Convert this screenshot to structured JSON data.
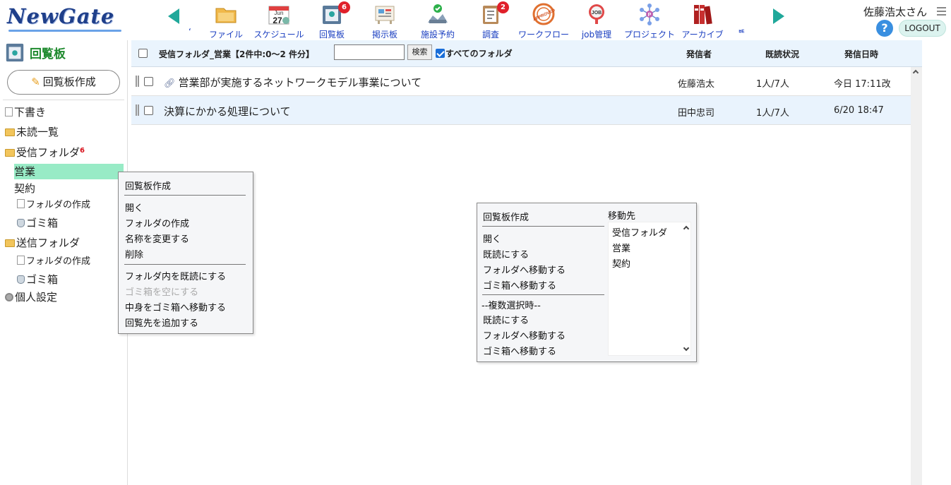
{
  "header": {
    "logo_part1": "New",
    "logo_part2": "Gate",
    "nav_fragment_left": "ʻ",
    "nav_fragment_right": "ᄩ",
    "nav_items": [
      {
        "label": "ファイル",
        "icon": "folder-icon",
        "badge": ""
      },
      {
        "label": "スケジュール",
        "icon": "calendar-icon",
        "badge": "",
        "icon_text_month": "Jun",
        "icon_text_day": "27"
      },
      {
        "label": "回覧板",
        "icon": "circular-board-icon",
        "badge": "6"
      },
      {
        "label": "掲示板",
        "icon": "bulletin-board-icon",
        "badge": ""
      },
      {
        "label": "施設予約",
        "icon": "facility-icon",
        "badge": ""
      },
      {
        "label": "調査",
        "icon": "survey-icon",
        "badge": "2"
      },
      {
        "label": "ワークフロー",
        "icon": "workflow-icon",
        "badge": "",
        "icon_text": "APPROVED"
      },
      {
        "label": "job管理",
        "icon": "job-icon",
        "badge": "",
        "icon_text": "JOB"
      },
      {
        "label": "プロジェクト",
        "icon": "project-icon",
        "badge": "",
        "icon_text": "P"
      },
      {
        "label": "アーカイブ",
        "icon": "archive-icon",
        "badge": ""
      }
    ],
    "user_name": "佐藤浩太さん",
    "help_label": "?",
    "logout_label": "LOGOUT"
  },
  "sidebar": {
    "app_title": "回覧板",
    "create_label": "回覧板作成",
    "tree": [
      {
        "label": "下書き",
        "icon": "document-icon"
      },
      {
        "label": "未読一覧",
        "icon": "unread-icon"
      },
      {
        "label": "受信フォルダ",
        "icon": "folder-icon",
        "badge": "6"
      },
      {
        "label": "営業",
        "icon": "",
        "selected": true
      },
      {
        "label": "契約",
        "icon": ""
      },
      {
        "label": "フォルダの作成",
        "icon": "new-folder-icon"
      },
      {
        "label": "ゴミ箱",
        "icon": "trash-icon"
      },
      {
        "label": "送信フォルダ",
        "icon": "folder-icon"
      },
      {
        "label": "フォルダの作成",
        "icon": "new-folder-icon"
      },
      {
        "label": "ゴミ箱",
        "icon": "trash-icon"
      },
      {
        "label": "個人設定",
        "icon": "gear-icon"
      }
    ]
  },
  "toolbar": {
    "title": "受信フォルダ_営業【2件中:0～2 件分】",
    "search_value": "",
    "search_button": "検索",
    "all_folders_label": "すべてのフォルダ",
    "all_folders_checked": true,
    "col_sender": "発信者",
    "col_read": "既読状況",
    "col_date": "発信日時"
  },
  "messages": [
    {
      "subject": "営業部が実施するネットワークモデル事業について",
      "attachment": true,
      "sender": "佐藤浩太",
      "read": "1人/7人",
      "date": "今日 17:11改"
    },
    {
      "subject": "決算にかかる処理について",
      "attachment": false,
      "sender": "田中忠司",
      "read": "1人/7人",
      "date": "6/20 18:47"
    }
  ],
  "folder_context_menu": {
    "items": [
      "回覧板作成",
      "開く",
      "フォルダの作成",
      "名称を変更する",
      "削除",
      "フォルダ内を既読にする",
      "ゴミ箱を空にする",
      "中身をゴミ箱へ移動する",
      "回覧先を追加する"
    ],
    "disabled_index": 6
  },
  "message_context_menu": {
    "items": [
      "回覧板作成",
      "開く",
      "既読にする",
      "フォルダへ移動する",
      "ゴミ箱へ移動する",
      "--複数選択時--",
      "既読にする",
      "フォルダへ移動する",
      "ゴミ箱へ移動する"
    ],
    "move_title": "移動先",
    "move_targets": [
      "受信フォルダ",
      "営業",
      "契約"
    ]
  }
}
